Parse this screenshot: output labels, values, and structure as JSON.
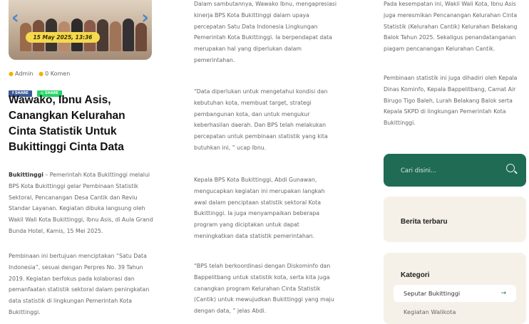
{
  "hero": {
    "date_badge": "15 May 2025, 13:36"
  },
  "meta": {
    "author": "Admin",
    "comments": "0 Komen"
  },
  "share": {
    "facebook": "SHARE",
    "whatsapp": "SHARE"
  },
  "article": {
    "title": "Wawako, Ibnu Asis, Canangkan Kelurahan Cinta Statistik Untuk Bukittinggi Cinta Data",
    "lead_place": "Bukittinggi",
    "lead_text": " – Pemerintah Kota Bukittinggi melalui BPS Kota Bukittinggi gelar Pembinaan Statistik Sektoral, Pencanangan Desa Cantik dan Reviu Standar Layanan. Kegiatan dibuka langsung oleh Wakil Wali Kota Bukittinggi, Ibnu Asis, di Aula Grand Bunda Hotel, Kamis, 15 Mei 2025.",
    "para2": "Pembinaan ini bertujuan menciptakan “Satu Data Indonesia”, sesuai dengan Perpres No. 39 Tahun 2019. Kegiatan berfokus pada kolaborasi dan pemanfaatan statistik sektoral dalam peningkatan data statistik di lingkungan Pemerintah Kota Bukittinggi.",
    "col2_p1": "Dalam sambutannya, Wawako Ibnu, mengapresiasi kinerja BPS Kota Bukittinggi dalam upaya percepatan Satu Data Indonesia Lingkungan Pemerintah Kota Bukittinggi. Ia berpendapat data merupakan hal yang diperlukan dalam pemerintahan.",
    "col2_p2": "“Data diperlukan untuk mengetahui kondisi dan kebutuhan kota, membuat target, strategi pembangunan kota, dan untuk mengukur keberhasilan daerah. Dan BPS telah melakukan percepatan untuk pembinaan statistik yang kita butuhkan ini, ” ucap Ibnu.",
    "col2_p3": "Kepala BPS Kota Bukittinggi, Abdi Gunawan, mengucapkan kegiatan ini merupakan langkah awal dalam penciptaan statistik sektoral Kota Bukittinggi. Ia juga menyampaikan beberapa program yang diciptakan untuk dapat meningkatkan data statistik pemerintahan.",
    "col2_p4": "“BPS telah berkoordinasi dengan Diskominfo dan Bappelitbang untuk statistik kota, serta kita juga canangkan program Kelurahan Cinta Statistik (Cantik) untuk mewujudkan Bukittinggi yang maju dengan data, ” jelas Abdi.",
    "col3_p1": "Pada kesempatan ini, Wakil Wali Kota, Ibnu Asis juga meresmikan Pencanangan Kelurahan Cinta Statistik (Kelurahan Cantik) Kelurahan Belakang Balok Tahun 2025. Sekaligus penandatanganan piagam pencanangan Kelurahan Cantik.",
    "col3_p2": "Pembinaan statistik ini juga dihadiri oleh Kepala Dinas Kominfo, Kepala Bappelitbang, Camat Air Birugo Tigo Baleh, Lurah Belakang Balok serta Kepala SKPD di lingkungan Pemerintah Kota Bukittinggi."
  },
  "sidebar": {
    "search_placeholder": "Cari disini...",
    "latest_title": "Berita terbaru",
    "category_title": "Kategori",
    "categories": [
      "Seputar Bukittinggi",
      "Kegiatan Walikota"
    ],
    "category_arrow": "→"
  },
  "colors": {
    "accent_green": "#1f6b54",
    "badge_yellow": "#f5d94f"
  }
}
